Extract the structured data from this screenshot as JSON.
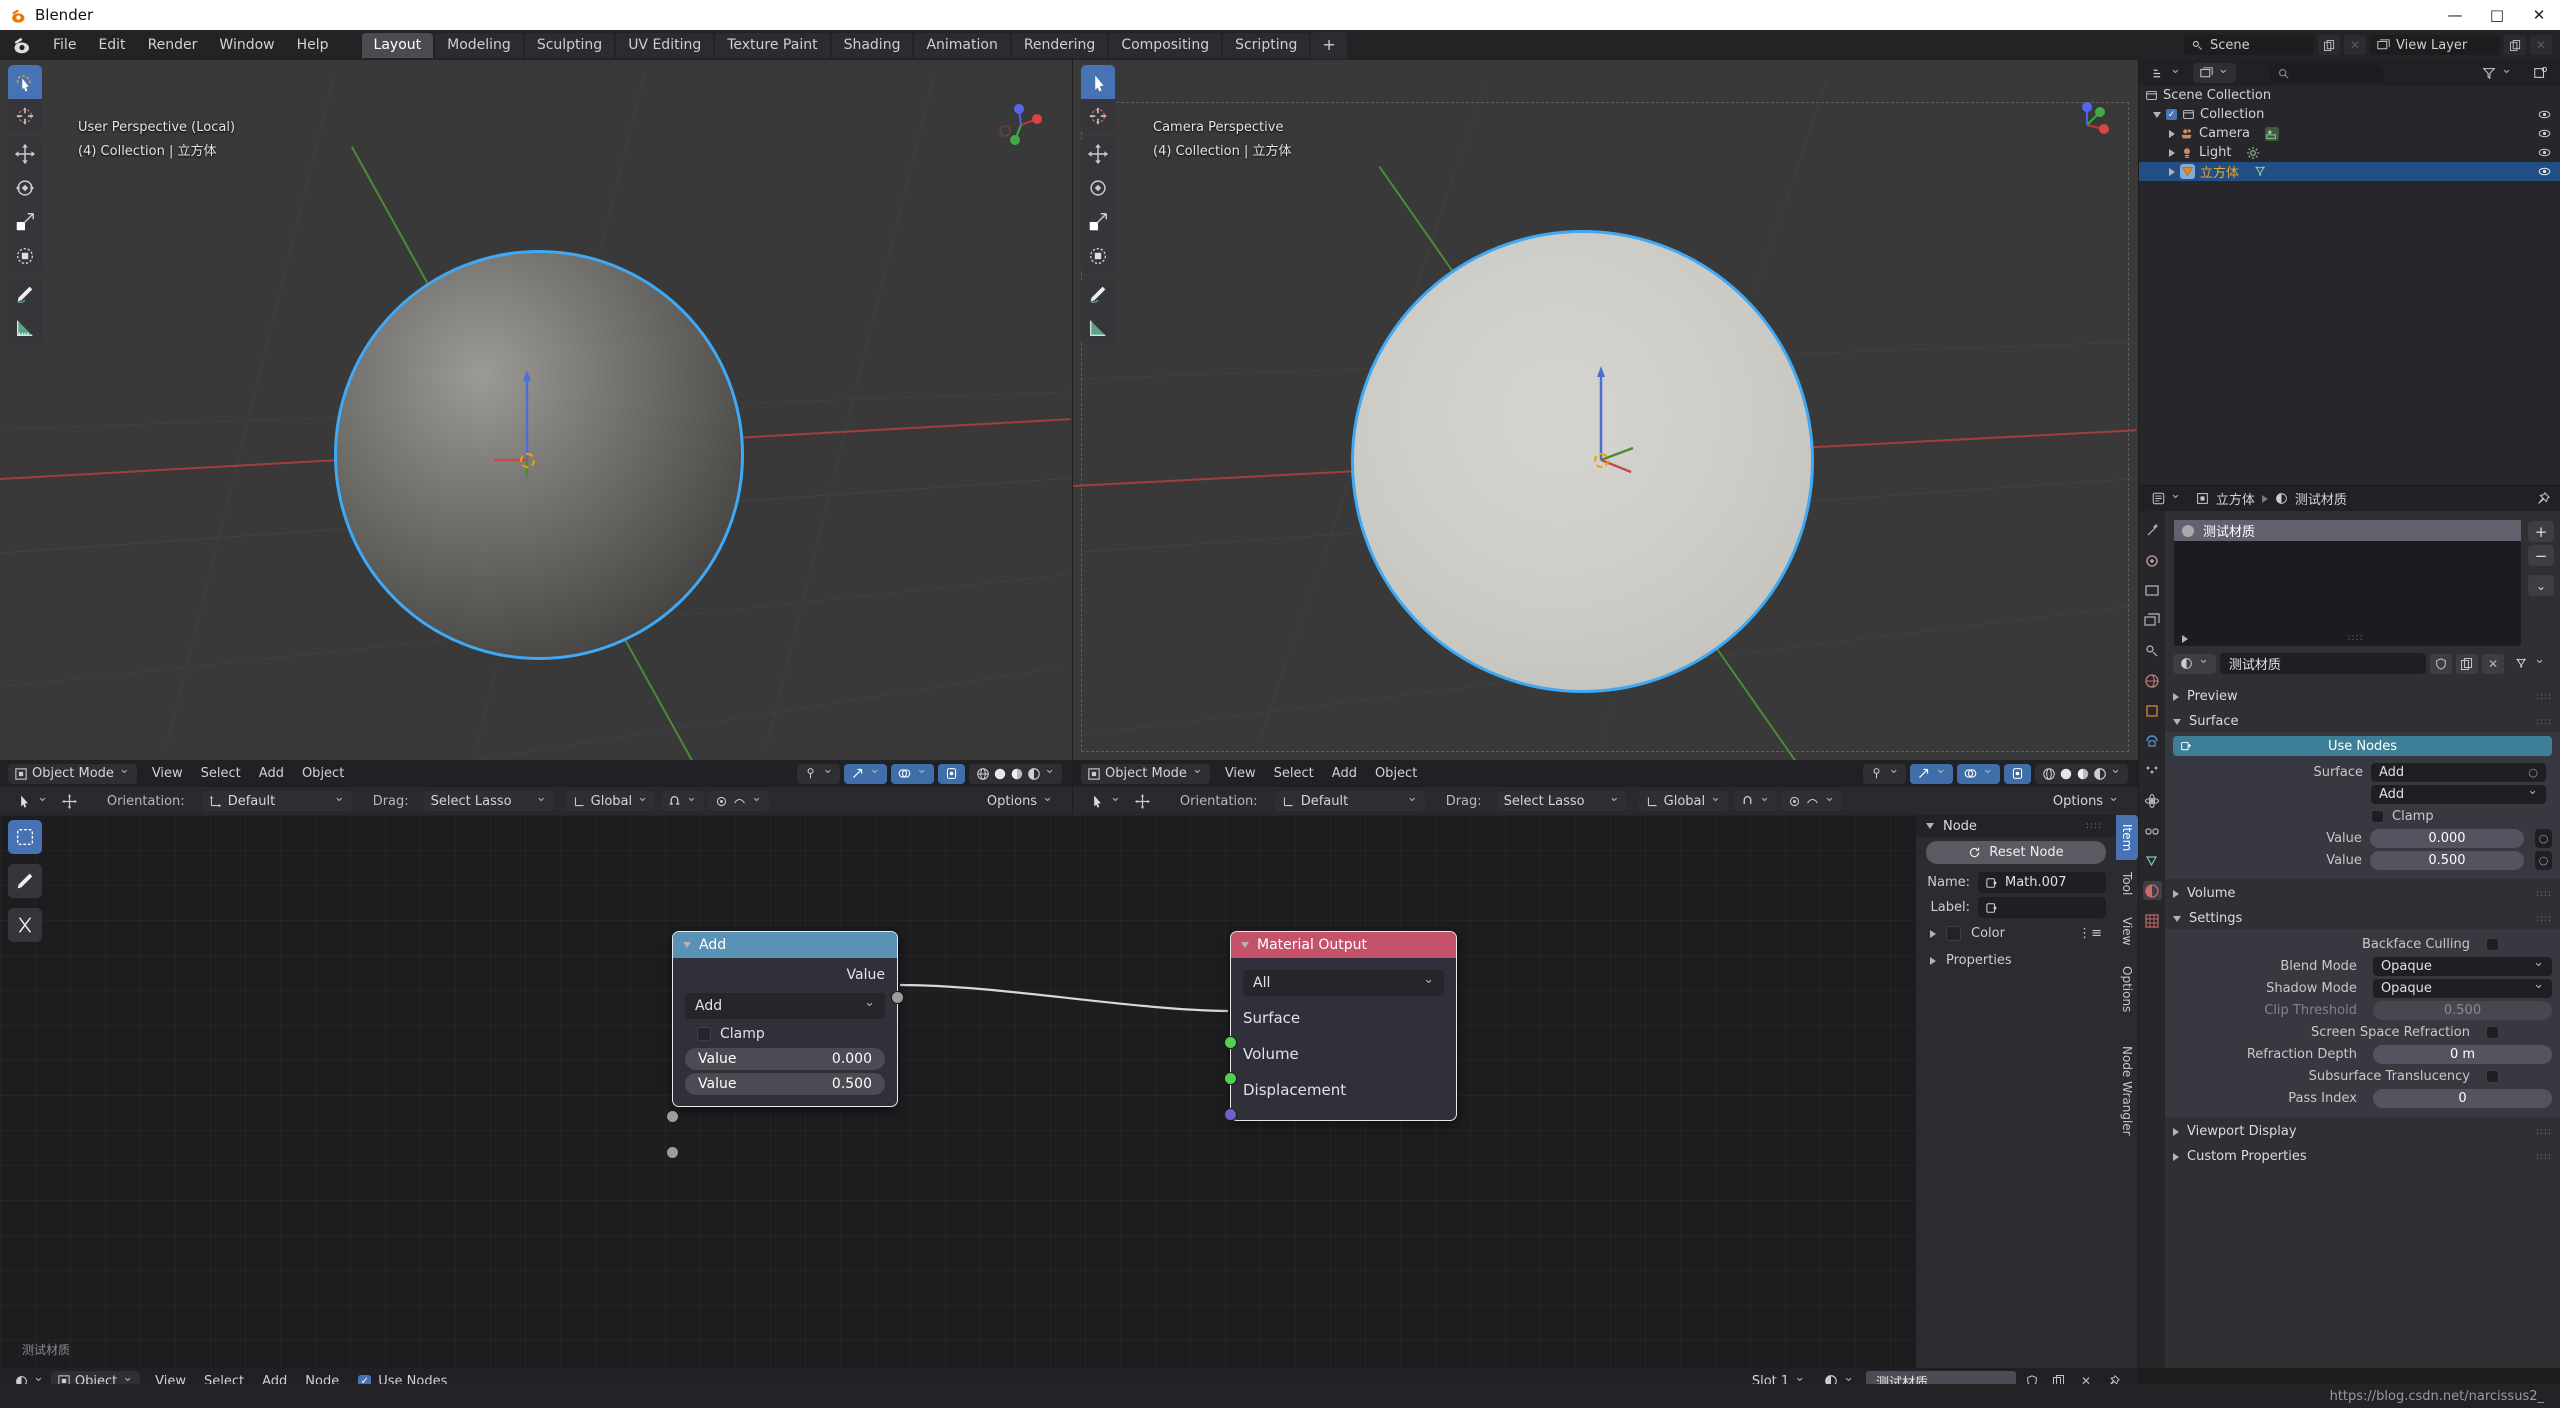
{
  "window": {
    "title": "Blender",
    "controls": [
      "—",
      "□",
      "✕"
    ]
  },
  "topbar": {
    "menus": [
      "File",
      "Edit",
      "Render",
      "Window",
      "Help"
    ],
    "tabs": [
      "Layout",
      "Modeling",
      "Sculpting",
      "UV Editing",
      "Texture Paint",
      "Shading",
      "Animation",
      "Rendering",
      "Compositing",
      "Scripting"
    ],
    "active_tab": "Layout",
    "add_tab_label": "+",
    "scene_label": "Scene",
    "viewlayer_label": "View Layer"
  },
  "viewport_left": {
    "overlay_line1": "User Perspective (Local)",
    "overlay_line2": "(4) Collection | 立方体",
    "header": {
      "mode": "Object Mode",
      "menus": [
        "View",
        "Select",
        "Add",
        "Object"
      ]
    },
    "toolbar2": {
      "orientation_label": "Orientation:",
      "orientation_value": "Default",
      "drag_label": "Drag:",
      "drag_value": "Select Lasso",
      "transform_value": "Global",
      "options_label": "Options"
    }
  },
  "viewport_right": {
    "overlay_line1": "Camera Perspective",
    "overlay_line2": "(4) Collection | 立方体",
    "header": {
      "mode": "Object Mode",
      "menus": [
        "View",
        "Select",
        "Add",
        "Object"
      ]
    },
    "toolbar2": {
      "orientation_label": "Orientation:",
      "orientation_value": "Default",
      "drag_label": "Drag:",
      "drag_value": "Select Lasso",
      "transform_value": "Global",
      "options_label": "Options"
    }
  },
  "node_editor": {
    "nodes": [
      {
        "title": "Add",
        "header_color": "#5992b5",
        "output_label": "Value",
        "operation": "Add",
        "clamp_label": "Clamp",
        "clamp_checked": false,
        "inputs": [
          {
            "label": "Value",
            "value": "0.000"
          },
          {
            "label": "Value",
            "value": "0.500"
          }
        ]
      },
      {
        "title": "Material Output",
        "header_color": "#c4526a",
        "target": "All",
        "sockets": [
          "Surface",
          "Volume",
          "Displacement"
        ]
      }
    ],
    "sidebar": {
      "panel_title": "Node",
      "reset_label": "Reset Node",
      "name_label": "Name:",
      "name_value": "Math.007",
      "label_label": "Label:",
      "label_value": "",
      "color_label": "Color",
      "properties_label": "Properties",
      "tabs": [
        "Item",
        "Tool",
        "View",
        "Options",
        "Node Wrangler"
      ],
      "active_tab": "Item"
    },
    "footer": {
      "editor_mode": "Object",
      "menus": [
        "View",
        "Select",
        "Add",
        "Node"
      ],
      "use_nodes_label": "Use Nodes",
      "use_nodes_checked": true,
      "slot_label": "Slot 1",
      "material_name": "测试材质"
    },
    "watermark": "测试材质"
  },
  "outliner": {
    "search_placeholder": "",
    "rows": [
      {
        "label": "Scene Collection",
        "indent": 0,
        "icon": "collection-icon",
        "selected": false,
        "eye": false
      },
      {
        "label": "Collection",
        "indent": 1,
        "icon": "collection-icon",
        "selected": false,
        "eye": true
      },
      {
        "label": "Camera",
        "indent": 2,
        "icon": "camera-icon",
        "selected": false,
        "eye": true
      },
      {
        "label": "Light",
        "indent": 2,
        "icon": "light-icon",
        "selected": false,
        "eye": true
      },
      {
        "label": "立方体",
        "indent": 2,
        "icon": "mesh-icon",
        "selected": true,
        "eye": true
      }
    ]
  },
  "properties": {
    "breadcrumb": [
      "立方体",
      "测试材质"
    ],
    "material_slot": "测试材质",
    "material_name_field": "测试材质",
    "slot_buttons": [
      "+",
      "−",
      "⌄"
    ],
    "sections": {
      "preview": "Preview",
      "surface": "Surface",
      "volume": "Volume",
      "settings": "Settings",
      "viewport_display": "Viewport Display",
      "custom_properties": "Custom Properties"
    },
    "surface": {
      "use_nodes": "Use Nodes",
      "surface_label": "Surface",
      "surface_value": "Add",
      "operation_value": "Add",
      "clamp_label": "Clamp",
      "value1_label": "Value",
      "value1": "0.000",
      "value2_label": "Value",
      "value2": "0.500"
    },
    "settings": {
      "backface_culling": "Backface Culling",
      "blend_mode_label": "Blend Mode",
      "blend_mode_value": "Opaque",
      "shadow_mode_label": "Shadow Mode",
      "shadow_mode_value": "Opaque",
      "clip_threshold_label": "Clip Threshold",
      "clip_threshold_value": "0.500",
      "screen_space_refraction": "Screen Space Refraction",
      "refraction_depth_label": "Refraction Depth",
      "refraction_depth_value": "0 m",
      "subsurface_translucency": "Subsurface Translucency",
      "pass_index_label": "Pass Index",
      "pass_index_value": "0"
    }
  },
  "statusbar": {
    "url": "https://blog.csdn.net/narcissus2_"
  },
  "colors": {
    "accent_blue": "#4772b3",
    "node_math": "#5992b5",
    "node_output": "#c4526a",
    "select_outline": "#3fa9f5",
    "teal": "#3d7f96"
  }
}
